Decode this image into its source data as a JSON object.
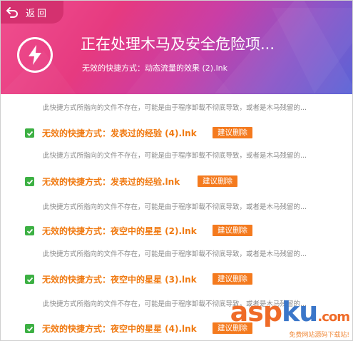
{
  "header": {
    "back_label": "返回",
    "title": "正在处理木马及安全危险项...",
    "current_item": "无效的快捷方式：动态流量的效果 (2).lnk"
  },
  "items": [
    {
      "name": "无效的快捷方式：发表过的经验 (4).lnk",
      "action": "建议删除",
      "checked": true
    },
    {
      "name": "无效的快捷方式：发表过的经验.lnk",
      "action": "建议删除",
      "checked": true
    },
    {
      "name": "无效的快捷方式：夜空中的星星 (2).lnk",
      "action": "建议删除",
      "checked": true
    },
    {
      "name": "无效的快捷方式：夜空中的星星 (3).lnk",
      "action": "建议删除",
      "checked": true
    },
    {
      "name": "无效的快捷方式：夜空中的星星 (4).lnk",
      "action": "建议删除",
      "checked": true
    }
  ],
  "descriptions": [
    "此快捷方式所指向的文件不存在，可能是由于程序卸载不彻底导致，或者是木马残留的...",
    "此快捷方式所指向的文件不存在，可能是由于程序卸载不彻底导致，或者是木马残留的...",
    "此快捷方式所指向的文件不存在，可能是由于程序卸载不彻底导致，或者是木马残留的...",
    "此快捷方式所指向的文件不存在，可能是由于程序卸载不彻底导致，或者是木马残留的...",
    "此快捷方式所指向的文件不存在，可能是由于程序卸载不彻底导致，或者是木马残留的..."
  ],
  "watermark": {
    "brand_a": "asp",
    "brand_b": "ku",
    "brand_c": ".com",
    "tagline": "免费网站源码下载站!"
  },
  "colors": {
    "accent": "#f47a1e",
    "check": "#3cb043",
    "header_start": "#f04f8e",
    "header_end": "#5a63d6"
  },
  "icons": {
    "back": "back-arrow-icon",
    "bolt": "lightning-bolt-icon",
    "check": "checkmark-icon"
  }
}
